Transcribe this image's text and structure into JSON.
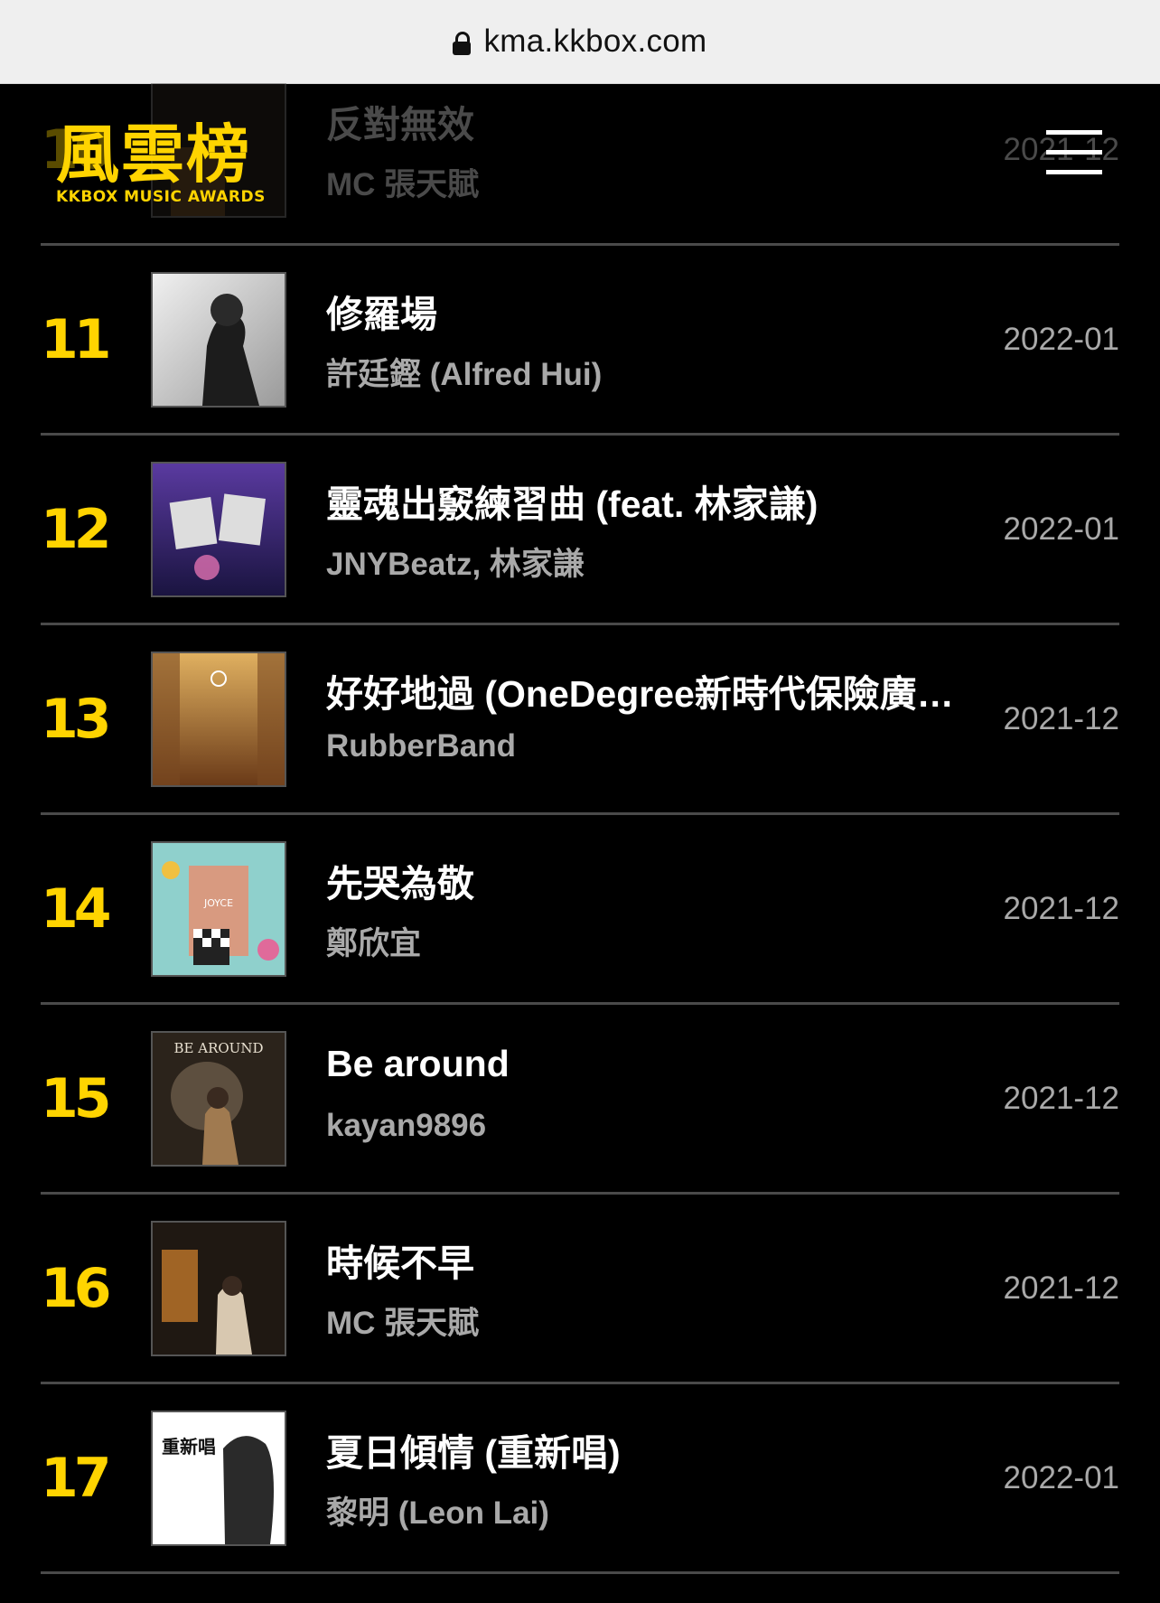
{
  "browser": {
    "url": "kma.kkbox.com"
  },
  "header": {
    "logo_main": "風雲榜",
    "logo_sub": "KKBOX MUSIC AWARDS",
    "menu_icon": "hamburger-menu-icon"
  },
  "chart": {
    "rows": [
      {
        "rank": "10",
        "title": "反對無效",
        "artist": "MC 張天賦",
        "date": "2021-12",
        "cover_colors": [
          "#1d1a15",
          "#6a4a22"
        ]
      },
      {
        "rank": "11",
        "title": "修羅場",
        "artist": "許廷鏗 (Alfred Hui)",
        "date": "2022-01",
        "cover_colors": [
          "#e8e8e8",
          "#2a2a2a"
        ]
      },
      {
        "rank": "12",
        "title": "靈魂出竅練習曲 (feat. 林家謙)",
        "artist": "JNYBeatz, 林家謙",
        "date": "2022-01",
        "cover_colors": [
          "#3b2a6e",
          "#c86aa8"
        ]
      },
      {
        "rank": "13",
        "title": "好好地過 (OneDegree新時代保險廣告歌)",
        "artist": "RubberBand",
        "date": "2021-12",
        "cover_colors": [
          "#c98a3a",
          "#5a3418"
        ]
      },
      {
        "rank": "14",
        "title": "先哭為敬",
        "artist": "鄭欣宜",
        "date": "2021-12",
        "cover_colors": [
          "#7fc8c8",
          "#e0a070"
        ]
      },
      {
        "rank": "15",
        "title": "Be around",
        "artist": "kayan9896",
        "date": "2021-12",
        "cover_colors": [
          "#2b231b",
          "#a07a50"
        ]
      },
      {
        "rank": "16",
        "title": "時候不早",
        "artist": "MC 張天賦",
        "date": "2021-12",
        "cover_colors": [
          "#2a2018",
          "#c0782a"
        ]
      },
      {
        "rank": "17",
        "title": "夏日傾情 (重新唱)",
        "artist": "黎明 (Leon Lai)",
        "date": "2022-01",
        "cover_colors": [
          "#ffffff",
          "#333333"
        ]
      }
    ]
  },
  "cover_text": {
    "r15": "BE AROUND",
    "r14": "JOYCE",
    "r17": "重新唱"
  }
}
